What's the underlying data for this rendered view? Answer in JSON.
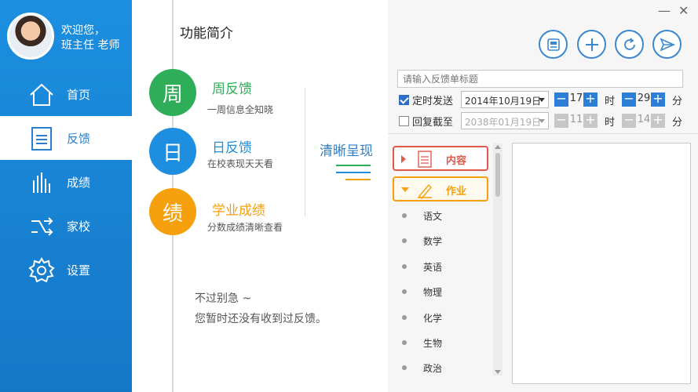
{
  "sidebar": {
    "welcome_line1": "欢迎您，",
    "welcome_line2": "班主任 老师",
    "items": [
      {
        "label": "首页",
        "icon": "home-icon"
      },
      {
        "label": "反馈",
        "icon": "document-icon"
      },
      {
        "label": "成绩",
        "icon": "bar-chart-icon"
      },
      {
        "label": "家校",
        "icon": "arrows-icon"
      },
      {
        "label": "设置",
        "icon": "gear-icon"
      }
    ],
    "active_index": 1
  },
  "intro": {
    "title": "功能简介",
    "features": [
      {
        "char": "周",
        "title": "周反馈",
        "desc": "一周信息全知晓",
        "color": "#2fae5a"
      },
      {
        "char": "日",
        "title": "日反馈",
        "desc": "在校表现天天看",
        "color": "#1e8fe0"
      },
      {
        "char": "绩",
        "title": "学业成绩",
        "desc": "分数成绩清晰查看",
        "color": "#f5a00c"
      }
    ],
    "side_text": "清晰呈现",
    "empty_line1": "不过别急 ~",
    "empty_line2": "您暂时还没有收到过反馈。"
  },
  "window": {
    "minimize": "—",
    "close": "✕"
  },
  "toolbar": {
    "buttons": [
      "template-icon",
      "plus-icon",
      "refresh-icon",
      "send-icon"
    ]
  },
  "form": {
    "title_placeholder": "请输入反馈单标题",
    "scheduled": {
      "label": "定时发送",
      "checked": true,
      "date": "2014年10月19日",
      "hour": "17",
      "minute": "29",
      "hour_unit": "时",
      "minute_unit": "分"
    },
    "deadline": {
      "label": "回复截至",
      "checked": false,
      "date": "2038年01月19日",
      "hour": "11",
      "minute": "14",
      "hour_unit": "时",
      "minute_unit": "分"
    }
  },
  "categories": {
    "content_label": "内容",
    "homework_label": "作业",
    "subjects": [
      "语文",
      "数学",
      "英语",
      "物理",
      "化学",
      "生物",
      "政治"
    ]
  },
  "colors": {
    "accent": "#2d7fd6",
    "content_red": "#e0584a",
    "homework_orange": "#f5a00c"
  }
}
